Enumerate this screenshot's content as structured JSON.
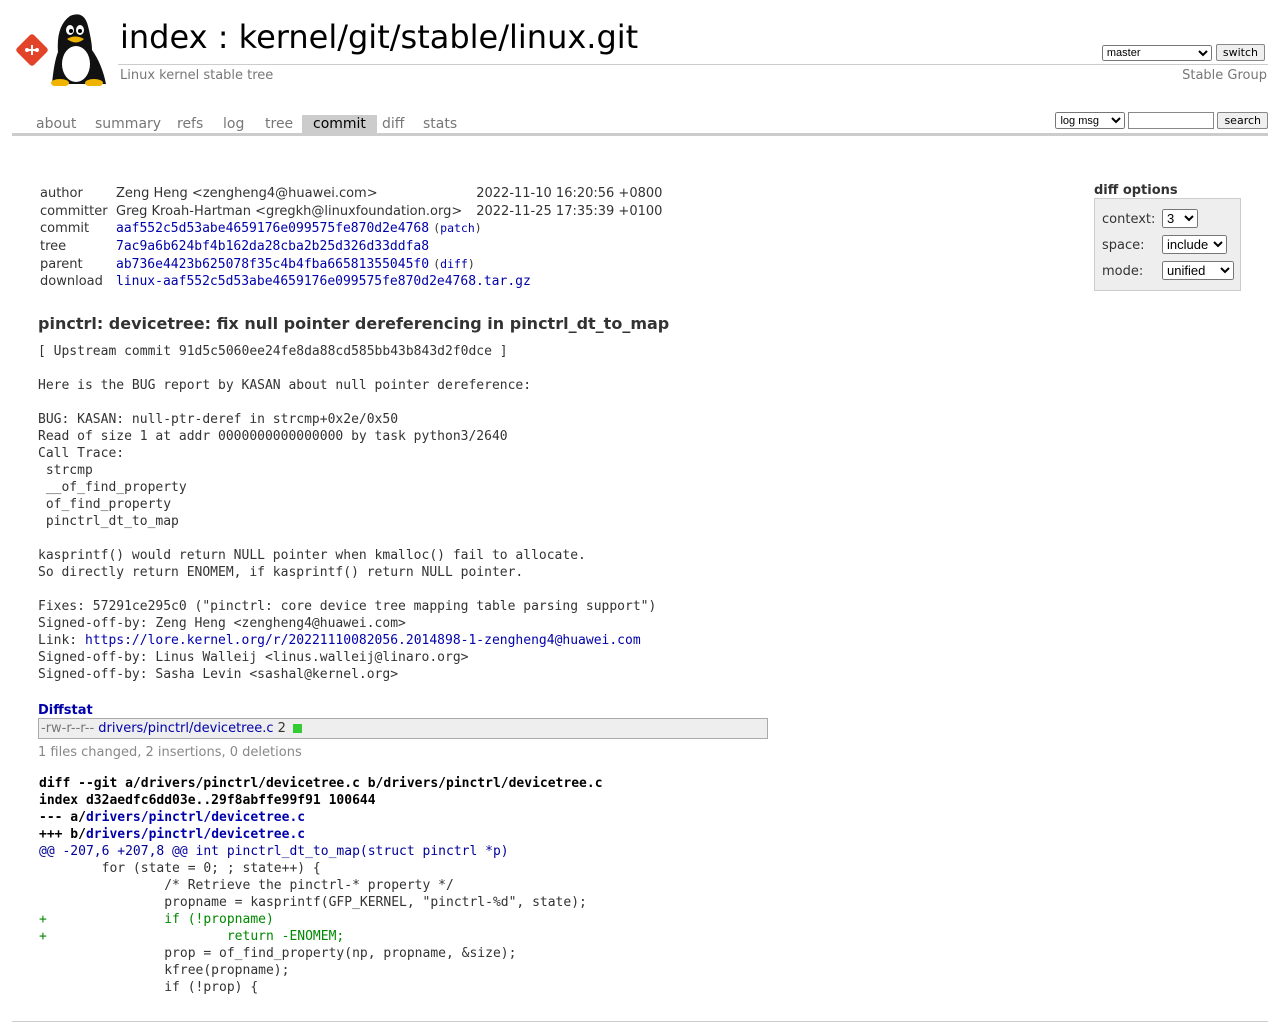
{
  "header": {
    "title_index": "index",
    "title_sep": " : ",
    "title_path": "kernel/git/stable/linux.git",
    "subtitle": "Linux kernel stable tree",
    "owner": "Stable Group",
    "branch_selected": "master",
    "switch_label": "switch"
  },
  "tabs": [
    "about",
    "summary",
    "refs",
    "log",
    "tree",
    "commit",
    "diff",
    "stats"
  ],
  "active_tab": "commit",
  "search": {
    "mode_selected": "log msg",
    "query": "",
    "button_label": "search"
  },
  "commit": {
    "author_label": "author",
    "author": "Zeng Heng <zengheng4@huawei.com>",
    "author_date": "2022-11-10 16:20:56 +0800",
    "committer_label": "committer",
    "committer": "Greg Kroah-Hartman <gregkh@linuxfoundation.org>",
    "committer_date": "2022-11-25 17:35:39 +0100",
    "commit_label": "commit",
    "commit_hash": "aaf552c5d53abe4659176e099575fe870d2e4768",
    "patch_link": "patch",
    "tree_label": "tree",
    "tree_hash": "7ac9a6b624bf4b162da28cba2b25d326d33ddfa8",
    "parent_label": "parent",
    "parent_hash": "ab736e4423b625078f35c4b4fba66581355045f0",
    "diff_link": "diff",
    "download_label": "download",
    "download_file": "linux-aaf552c5d53abe4659176e099575fe870d2e4768.tar.gz"
  },
  "diff_options": {
    "title": "diff options",
    "context_label": "context:",
    "context_value": "3",
    "space_label": "space:",
    "space_value": "include",
    "mode_label": "mode:",
    "mode_value": "unified"
  },
  "message": {
    "subject": "pinctrl: devicetree: fix null pointer dereferencing in pinctrl_dt_to_map",
    "body_before_link": "[ Upstream commit 91d5c5060ee24fe8da88cd585bb43b843d2f0dce ]\n\nHere is the BUG report by KASAN about null pointer dereference:\n\nBUG: KASAN: null-ptr-deref in strcmp+0x2e/0x50\nRead of size 1 at addr 0000000000000000 by task python3/2640\nCall Trace:\n strcmp\n __of_find_property\n of_find_property\n pinctrl_dt_to_map\n\nkasprintf() would return NULL pointer when kmalloc() fail to allocate.\nSo directly return ENOMEM, if kasprintf() return NULL pointer.\n\nFixes: 57291ce295c0 (\"pinctrl: core device tree mapping table parsing support\")\nSigned-off-by: Zeng Heng <zengheng4@huawei.com>\nLink: ",
    "link": "https://lore.kernel.org/r/20221110082056.2014898-1-zengheng4@huawei.com",
    "body_after_link": "\nSigned-off-by: Linus Walleij <linus.walleij@linaro.org>\nSigned-off-by: Sasha Levin <sashal@kernel.org>"
  },
  "diffstat": {
    "header": "Diffstat",
    "mode": "-rw-r--r--",
    "file": "drivers/pinctrl/devicetree.c",
    "changes": "2",
    "summary": "1 files changed, 2 insertions, 0 deletions"
  },
  "diff": {
    "line1": "diff --git a/drivers/pinctrl/devicetree.c b/drivers/pinctrl/devicetree.c",
    "line2": "index d32aedfc6dd03e..29f8abffe99f91 100644",
    "minus_prefix": "--- a/",
    "minus_file": "drivers/pinctrl/devicetree.c",
    "plus_prefix": "+++ b/",
    "plus_file": "drivers/pinctrl/devicetree.c",
    "hunk": "@@ -207,6 +207,8 @@ int pinctrl_dt_to_map(struct pinctrl *p)",
    "lines": [
      {
        "type": "ctx",
        "text": "        for (state = 0; ; state++) {"
      },
      {
        "type": "ctx",
        "text": "                /* Retrieve the pinctrl-* property */"
      },
      {
        "type": "ctx",
        "text": "                propname = kasprintf(GFP_KERNEL, \"pinctrl-%d\", state);"
      },
      {
        "type": "add",
        "text": "+               if (!propname)"
      },
      {
        "type": "add",
        "text": "+                       return -ENOMEM;"
      },
      {
        "type": "ctx",
        "text": "                prop = of_find_property(np, propname, &size);"
      },
      {
        "type": "ctx",
        "text": "                kfree(propname);"
      },
      {
        "type": "ctx",
        "text": "                if (!prop) {"
      }
    ]
  },
  "colors": {
    "link": "#0000aa",
    "tab_active_bg": "#cccccc",
    "added_line": "#008800",
    "hunk_header": "#000099",
    "diffstat_bar": "#33cc33"
  }
}
